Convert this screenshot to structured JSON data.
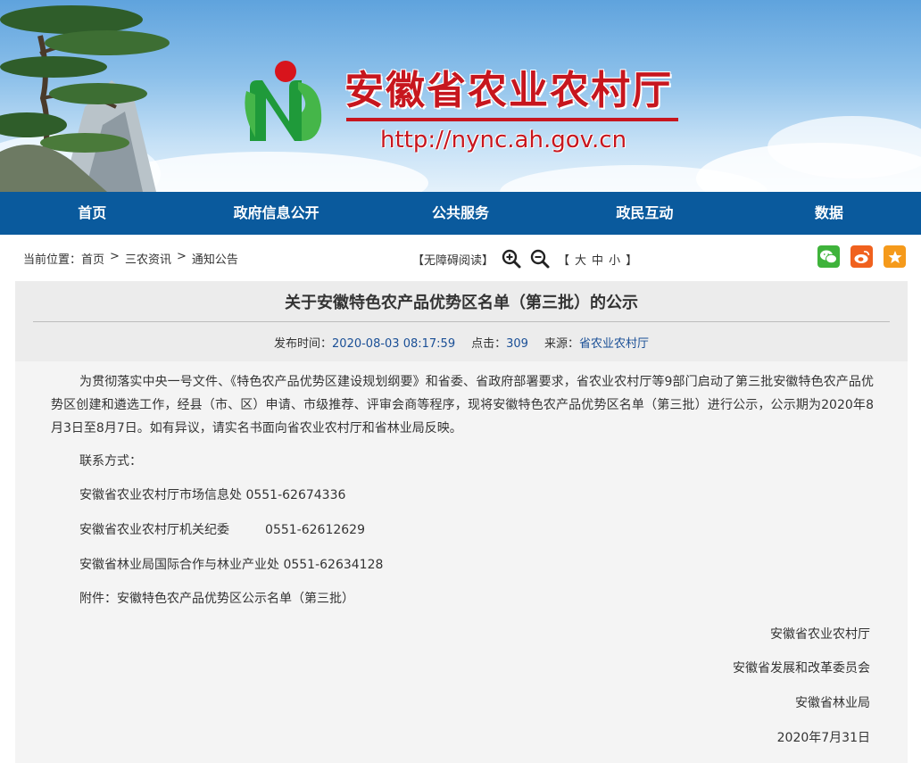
{
  "site": {
    "name": "安徽省农业农村厅",
    "url": "http://nync.ah.gov.cn"
  },
  "colors": {
    "brand_red": "#c7161e",
    "nav_blue": "#0a5a9d",
    "wechat_green": "#3fb33b",
    "weibo_orange": "#f0611e",
    "favorite_orange": "#f59a1b",
    "link_blue": "#1a4f96"
  },
  "nav": {
    "items": [
      {
        "label": "首页"
      },
      {
        "label": "政府信息公开"
      },
      {
        "label": "公共服务"
      },
      {
        "label": "政民互动"
      },
      {
        "label": "数据"
      }
    ]
  },
  "toolbar": {
    "breadcrumb_prefix": "当前位置：",
    "breadcrumb": [
      {
        "label": "首页"
      },
      {
        "label": "三农资讯"
      },
      {
        "label": "通知公告"
      }
    ],
    "breadcrumb_sep": ">",
    "accessible_reading": "【无障碍阅读】",
    "zoom_in_icon": "zoom-in-icon",
    "zoom_out_icon": "zoom-out-icon",
    "size_open": "【",
    "size_large": "大",
    "size_medium": "中",
    "size_small": "小",
    "size_close": "】",
    "share_icons": [
      "wechat-icon",
      "weibo-icon",
      "favorite-icon"
    ]
  },
  "article": {
    "title": "关于安徽特色农产品优势区名单（第三批）的公示",
    "publish_label": "发布时间：",
    "publish_time": "2020-08-03 08:17:59",
    "clicks_label": "点击：",
    "clicks": "309",
    "source_label": "来源：",
    "source": "省农业农村厅",
    "intro": "为贯彻落实中央一号文件、《特色农产品优势区建设规划纲要》和省委、省政府部署要求，省农业农村厅等9部门启动了第三批安徽特色农产品优势区创建和遴选工作，经县（市、区）申请、市级推荐、评审会商等程序，现将安徽特色农产品优势区名单（第三批）进行公示，公示期为2020年8月3日至8月7日。如有异议，请实名书面向省农业农村厅和省林业局反映。",
    "contact_heading": "联系方式：",
    "contacts": [
      "安徽省农业农村厅市场信息处 0551-62674336",
      "安徽省农业农村厅机关纪委         0551-62612629",
      "安徽省林业局国际合作与林业产业处 0551-62634128"
    ],
    "attachment": "附件：安徽特色农产品优势区公示名单（第三批）",
    "signatures": [
      "安徽省农业农村厅",
      "安徽省发展和改革委员会",
      "安徽省林业局"
    ],
    "date": "2020年7月31日"
  }
}
